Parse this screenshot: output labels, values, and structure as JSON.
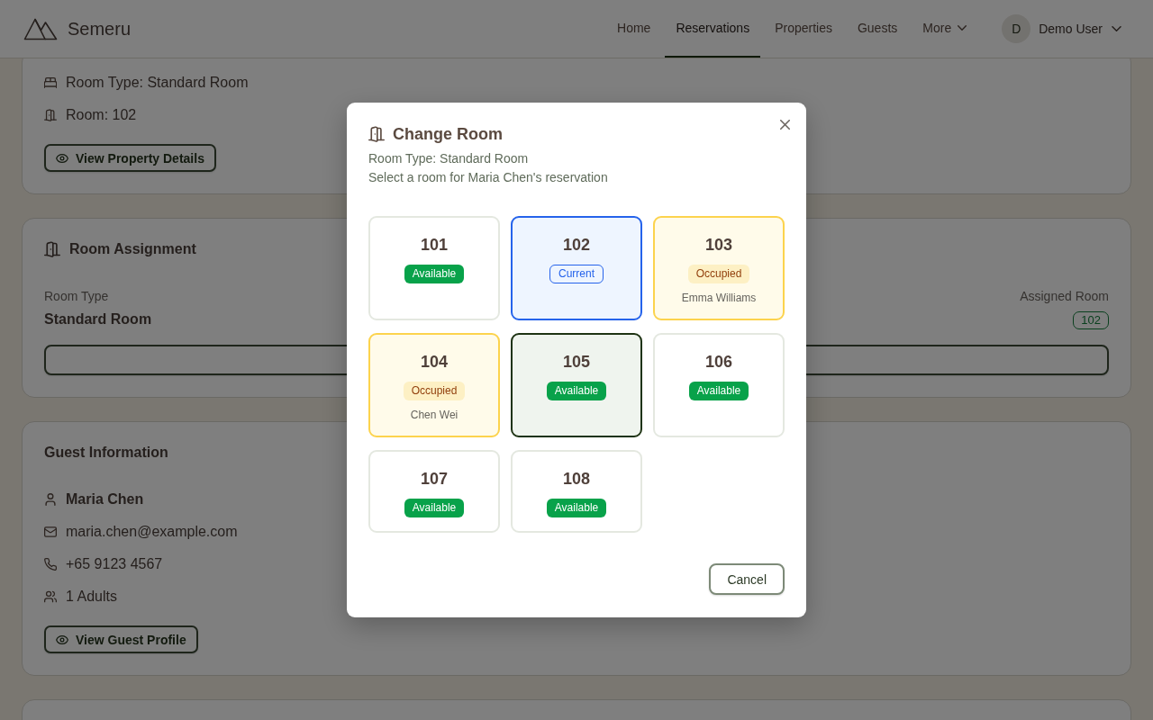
{
  "header": {
    "brand": "Semeru",
    "nav": [
      {
        "label": "Home",
        "kind": "link",
        "selected": false
      },
      {
        "label": "Reservations",
        "kind": "link",
        "selected": true
      },
      {
        "label": "Properties",
        "kind": "link",
        "selected": false
      },
      {
        "label": "Guests",
        "kind": "link",
        "selected": false
      },
      {
        "label": "More",
        "kind": "menu",
        "selected": false
      }
    ],
    "user": {
      "initial": "D",
      "name": "Demo User"
    }
  },
  "property_card": {
    "rows": [
      {
        "kind": "roomtype",
        "text": "Room Type: Standard Room"
      },
      {
        "kind": "room",
        "text": "Room: 102"
      }
    ],
    "button": "View Property Details"
  },
  "room_assignment": {
    "title": "Room Assignment",
    "room_type": {
      "label": "Room Type",
      "value": "Standard Room"
    },
    "assigned_room": {
      "label": "Assigned Room",
      "value": "102"
    }
  },
  "guest_information": {
    "title": "Guest Information",
    "rows": [
      {
        "kind": "name",
        "text": "Maria Chen"
      },
      {
        "kind": "email",
        "text": "maria.chen@example.com"
      },
      {
        "kind": "phone",
        "text": "+65 9123 4567"
      },
      {
        "kind": "party",
        "text": "1 Adults"
      }
    ],
    "button": "View Guest Profile"
  },
  "modal": {
    "title": "Change Room",
    "subtitle": [
      "Room Type: Standard Room",
      "Select a room for Maria Chen's reservation"
    ],
    "rooms": [
      {
        "number": "101",
        "kind": "available",
        "status": "Available",
        "selected": false
      },
      {
        "number": "102",
        "kind": "current",
        "status": "Current",
        "selected": false
      },
      {
        "number": "103",
        "kind": "occupied",
        "status": "Occupied",
        "guest": "Emma Williams",
        "selected": false
      },
      {
        "number": "104",
        "kind": "occupied",
        "status": "Occupied",
        "guest": "Chen Wei",
        "selected": false
      },
      {
        "number": "105",
        "kind": "available",
        "status": "Available",
        "selected": true
      },
      {
        "number": "106",
        "kind": "available",
        "status": "Available",
        "selected": false
      },
      {
        "number": "107",
        "kind": "available",
        "status": "Available",
        "selected": false
      },
      {
        "number": "108",
        "kind": "available",
        "status": "Available",
        "selected": false
      }
    ],
    "cancel": "Cancel"
  }
}
